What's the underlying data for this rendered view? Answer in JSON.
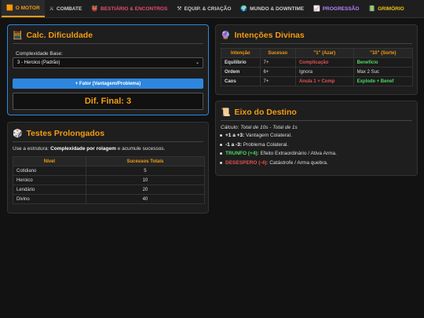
{
  "colors": {
    "accent": "#f39c12",
    "blue": "#2e86de",
    "red": "#e05252",
    "green": "#4cd964",
    "pink": "#e74c6f",
    "purple": "#b884ff"
  },
  "nav": {
    "tabs": [
      {
        "icon": "engine-icon",
        "glyph": "🟧",
        "label": "O MOTOR",
        "color": "#f39c12",
        "active": true
      },
      {
        "icon": "swords-icon",
        "glyph": "⚔",
        "label": "COMBATE",
        "color": "#cccccc"
      },
      {
        "icon": "monster-icon",
        "glyph": "👹",
        "label": "BESTIÁRIO & ENCONTROS",
        "color": "#e74c6f"
      },
      {
        "icon": "tools-icon",
        "glyph": "⚒",
        "label": "EQUIP. & CRIAÇÃO",
        "color": "#cccccc"
      },
      {
        "icon": "globe-icon",
        "glyph": "🌍",
        "label": "MUNDO & DOWNTIME",
        "color": "#cccccc"
      },
      {
        "icon": "chart-icon",
        "glyph": "📈",
        "label": "PROGRESSÃO",
        "color": "#b884ff"
      },
      {
        "icon": "book-icon",
        "glyph": "📗",
        "label": "GRIMÓRIO",
        "color": "#f1c40f"
      }
    ]
  },
  "calc": {
    "icon": "abacus-icon",
    "title": "Calc. Dificuldade",
    "field_label": "Complexidade Base:",
    "select_value": "3 - Heroico (Padrão)",
    "button": "+ Fator (Vantagem/Problema)",
    "final": "Dif. Final: 3"
  },
  "divine": {
    "icon": "crystal-ball-icon",
    "title": "Intenções Divinas",
    "headers": [
      "Intenção",
      "Sucesso",
      "\"1\" (Azar)",
      "\"10\" (Sorte)"
    ],
    "rows": [
      {
        "intent": "Equilíbrio",
        "success": "7+",
        "bad": "Complicação",
        "bad_color": "#e05252",
        "good": "Benefício",
        "good_color": "#4cd964"
      },
      {
        "intent": "Ordem",
        "success": "6+",
        "bad": "Ignora",
        "bad_color": "#dddddd",
        "good": "Max 2 Suc",
        "good_color": "#dddddd"
      },
      {
        "intent": "Caos",
        "success": "7+",
        "bad": "Anula 1 + Comp",
        "bad_color": "#e05252",
        "good": "Explode + Benef",
        "good_color": "#4cd964"
      }
    ]
  },
  "prolonged": {
    "icon": "dice-icon",
    "title": "Testes Prolongados",
    "intro_prefix": "Use a estrutura: ",
    "intro_bold": "Complexidade por rolagem",
    "intro_suffix": " e acumule sucessos.",
    "headers": [
      "Nível",
      "Sucessos Totais"
    ],
    "rows": [
      {
        "level": "Cotidiano",
        "total": "5"
      },
      {
        "level": "Heroico",
        "total": "10"
      },
      {
        "level": "Lendário",
        "total": "20"
      },
      {
        "level": "Divino",
        "total": "40"
      }
    ]
  },
  "destiny": {
    "icon": "scroll-icon",
    "title": "Eixo do Destino",
    "calc_note": "Cálculo: Total de 10s - Total de 1s",
    "items": [
      {
        "bold": "+1 a +3:",
        "rest": " Vantagem Colateral.",
        "color": "#ffffff"
      },
      {
        "bold": "-1 a -3:",
        "rest": " Problema Colateral.",
        "color": "#ffffff"
      },
      {
        "bold": "TRUNFO (+4):",
        "rest": " Efeito Extraordinário / Ativa Arma.",
        "color": "#4cd964"
      },
      {
        "bold": "DESESPERO (-4):",
        "rest": " Catástrofe / Arma quebra.",
        "color": "#e05252"
      }
    ]
  }
}
